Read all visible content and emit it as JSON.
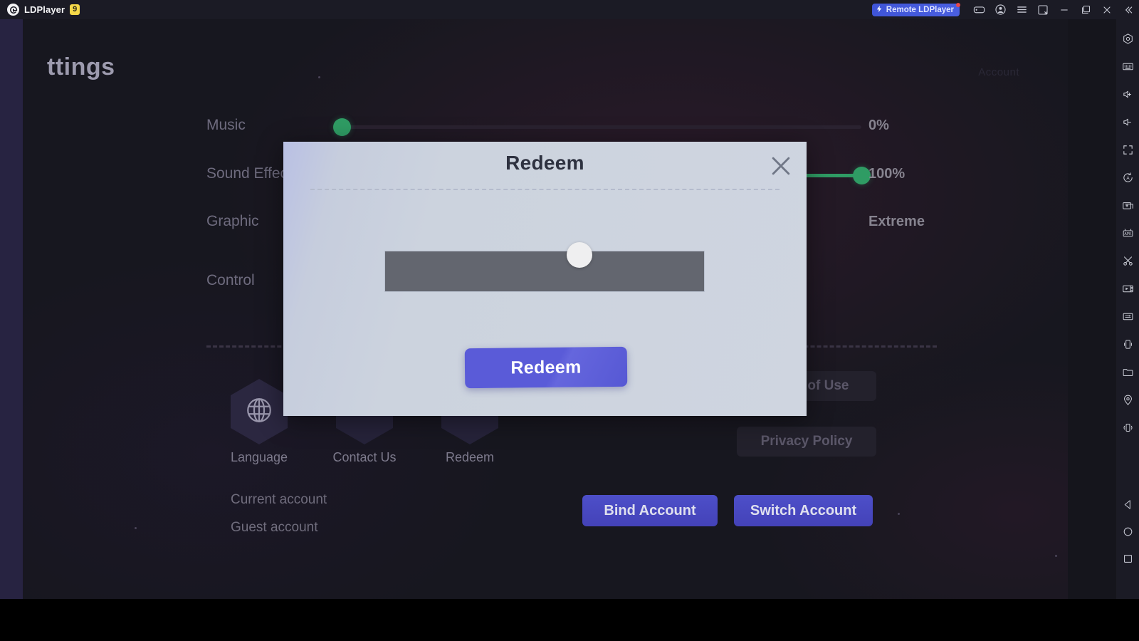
{
  "titlebar": {
    "app_name": "LDPlayer",
    "version_badge": "9",
    "remote_label": "Remote LDPlayer",
    "icons": [
      {
        "name": "gamepad-icon",
        "label": "Gamepad"
      },
      {
        "name": "account-icon",
        "label": "Account"
      },
      {
        "name": "menu-icon",
        "label": "Menu"
      },
      {
        "name": "window-snap-icon",
        "label": "Window snap"
      },
      {
        "name": "minimize-icon",
        "label": "Minimize"
      },
      {
        "name": "maximize-icon",
        "label": "Maximize"
      },
      {
        "name": "close-icon",
        "label": "Close"
      },
      {
        "name": "collapse-icon",
        "label": "Collapse"
      }
    ]
  },
  "game": {
    "page_title": "ttings",
    "topright_faint": "Account",
    "settings": [
      {
        "label": "Music",
        "value": "0%",
        "percent": 0
      },
      {
        "label": "Sound Effect",
        "value": "100%",
        "percent": 100
      },
      {
        "label": "Graphic",
        "value": "Extreme",
        "percent": null
      },
      {
        "label": "Control",
        "value": "",
        "percent": null
      }
    ],
    "hex_buttons": [
      {
        "label": "Language",
        "icon": "globe-icon"
      },
      {
        "label": "Contact Us",
        "icon": "globe-icon"
      },
      {
        "label": "Redeem",
        "icon": "globe-icon"
      }
    ],
    "policy_buttons": [
      {
        "label": "Terms of Use"
      },
      {
        "label": "Privacy Policy"
      }
    ],
    "account": {
      "current_label": "Current account",
      "account_name": "Guest account",
      "bind_label": "Bind Account",
      "switch_label": "Switch Account"
    }
  },
  "modal": {
    "title": "Redeem",
    "close_icon": "close-icon",
    "input_value": "",
    "input_placeholder": "",
    "submit_label": "Redeem"
  },
  "sidebar": {
    "tools": [
      {
        "name": "settings-icon",
        "label": "Settings"
      },
      {
        "name": "keyboard-icon",
        "label": "Keyboard mapping"
      },
      {
        "name": "volume-up-icon",
        "label": "Volume up"
      },
      {
        "name": "volume-down-icon",
        "label": "Volume down"
      },
      {
        "name": "fullscreen-icon",
        "label": "Fullscreen"
      },
      {
        "name": "auto-rotate-icon",
        "label": "Rotate"
      },
      {
        "name": "multi-instance-icon",
        "label": "Multi-instance"
      },
      {
        "name": "apk-install-icon",
        "label": "Install APK"
      },
      {
        "name": "scissors-icon",
        "label": "Screenshot"
      },
      {
        "name": "video-record-icon",
        "label": "Record"
      },
      {
        "name": "script-icon",
        "label": "Operation recorder"
      },
      {
        "name": "shake-icon",
        "label": "Shake"
      },
      {
        "name": "folder-icon",
        "label": "Shared folder"
      },
      {
        "name": "location-icon",
        "label": "Virtual location"
      },
      {
        "name": "vibrate-icon",
        "label": "Vibrate"
      }
    ],
    "nav": [
      {
        "name": "back-icon",
        "label": "Back"
      },
      {
        "name": "home-icon",
        "label": "Home"
      },
      {
        "name": "recents-icon",
        "label": "Recents"
      }
    ]
  },
  "colors": {
    "accent_purple": "#5a5bd8",
    "slider_green": "#2f9c64",
    "titlebar_bg": "#1b1b25",
    "modal_bg": "#ccd3de",
    "input_bg": "#63666f"
  }
}
